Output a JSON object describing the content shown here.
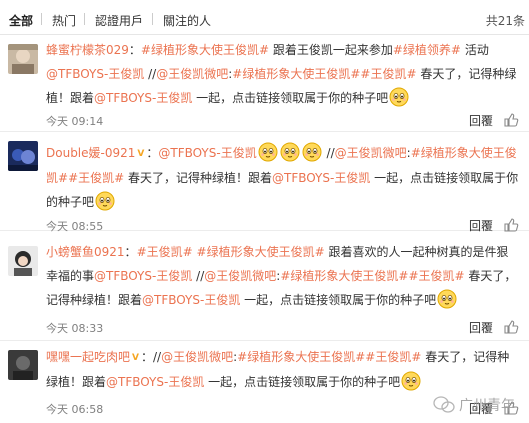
{
  "tabs": [
    {
      "label": "全部"
    },
    {
      "label": "热门"
    },
    {
      "label": "認證用戶"
    },
    {
      "label": "關注的人"
    }
  ],
  "total_count": "共21条",
  "comments": [
    {
      "time": "今天 09:14",
      "reply_label": "回覆",
      "segments": [
        {
          "type": "user",
          "text": "蜂蜜柠檬茶029"
        },
        {
          "type": "text",
          "text": "："
        },
        {
          "type": "tag",
          "text": "#绿植形象大使王俊凯#"
        },
        {
          "type": "text",
          "text": " 跟着王俊凯一起来参加"
        },
        {
          "type": "tag",
          "text": "#绿植领养#"
        },
        {
          "type": "text",
          "text": " 活动 "
        },
        {
          "type": "mention",
          "text": "@TFBOYS-王俊凯"
        },
        {
          "type": "text",
          "text": " //"
        },
        {
          "type": "mention",
          "text": "@王俊凯微吧"
        },
        {
          "type": "text",
          "text": ":"
        },
        {
          "type": "tag",
          "text": "#绿植形象大使王俊凯#"
        },
        {
          "type": "tag",
          "text": "#王俊凯#"
        },
        {
          "type": "text",
          "text": " 春天了，记得种绿植！跟着"
        },
        {
          "type": "mention",
          "text": "@TFBOYS-王俊凯"
        },
        {
          "type": "text",
          "text": " 一起，点击链接领取属于你的种子吧"
        },
        {
          "type": "emoji",
          "text": ""
        }
      ]
    },
    {
      "time": "今天 08:55",
      "reply_label": "回覆",
      "segments": [
        {
          "type": "user",
          "text": "Double媛-0921"
        },
        {
          "type": "vip",
          "text": "V"
        },
        {
          "type": "text",
          "text": "："
        },
        {
          "type": "mention",
          "text": "@TFBOYS-王俊凯"
        },
        {
          "type": "emoji",
          "text": ""
        },
        {
          "type": "emoji",
          "text": ""
        },
        {
          "type": "emoji",
          "text": ""
        },
        {
          "type": "text",
          "text": " //"
        },
        {
          "type": "mention",
          "text": "@王俊凯微吧"
        },
        {
          "type": "text",
          "text": ":"
        },
        {
          "type": "tag",
          "text": "#绿植形象大使王俊凯#"
        },
        {
          "type": "tag",
          "text": "#王俊凯#"
        },
        {
          "type": "text",
          "text": " 春天了，记得种绿植！跟着"
        },
        {
          "type": "mention",
          "text": "@TFBOYS-王俊凯"
        },
        {
          "type": "text",
          "text": " 一起，点击链接领取属于你的种子吧"
        },
        {
          "type": "emoji",
          "text": ""
        }
      ]
    },
    {
      "time": "今天 08:33",
      "reply_label": "回覆",
      "segments": [
        {
          "type": "user",
          "text": "小螃蟹鱼0921"
        },
        {
          "type": "text",
          "text": "："
        },
        {
          "type": "tag",
          "text": "#王俊凯#"
        },
        {
          "type": "text",
          "text": " "
        },
        {
          "type": "tag",
          "text": "#绿植形象大使王俊凯#"
        },
        {
          "type": "text",
          "text": " 跟着喜欢的人一起种树真的是件狠幸福的事"
        },
        {
          "type": "mention",
          "text": "@TFBOYS-王俊凯"
        },
        {
          "type": "text",
          "text": " //"
        },
        {
          "type": "mention",
          "text": "@王俊凯微吧"
        },
        {
          "type": "text",
          "text": ":"
        },
        {
          "type": "tag",
          "text": "#绿植形象大使王俊凯#"
        },
        {
          "type": "tag",
          "text": "#王俊凯#"
        },
        {
          "type": "text",
          "text": " 春天了，记得种绿植！跟着"
        },
        {
          "type": "mention",
          "text": "@TFBOYS-王俊凯"
        },
        {
          "type": "text",
          "text": " 一起，点击链接领取属于你的种子吧"
        },
        {
          "type": "emoji",
          "text": ""
        }
      ]
    },
    {
      "time": "今天 06:58",
      "reply_label": "回覆",
      "segments": [
        {
          "type": "user",
          "text": "嘿嘿一起吃肉吧"
        },
        {
          "type": "vip",
          "text": "V"
        },
        {
          "type": "text",
          "text": "：//"
        },
        {
          "type": "mention",
          "text": "@王俊凯微吧"
        },
        {
          "type": "text",
          "text": ":"
        },
        {
          "type": "tag",
          "text": "#绿植形象大使王俊凯#"
        },
        {
          "type": "tag",
          "text": "#王俊凯#"
        },
        {
          "type": "text",
          "text": " 春天了，记得种绿植！跟着"
        },
        {
          "type": "mention",
          "text": "@TFBOYS-王俊凯"
        },
        {
          "type": "text",
          "text": " 一起，点击链接领取属于你的种子吧"
        },
        {
          "type": "emoji",
          "text": ""
        }
      ]
    }
  ],
  "watermark": "广州青年",
  "colors": {
    "accent": "#eb7350",
    "time": "#808080",
    "divider": "#ececec"
  }
}
